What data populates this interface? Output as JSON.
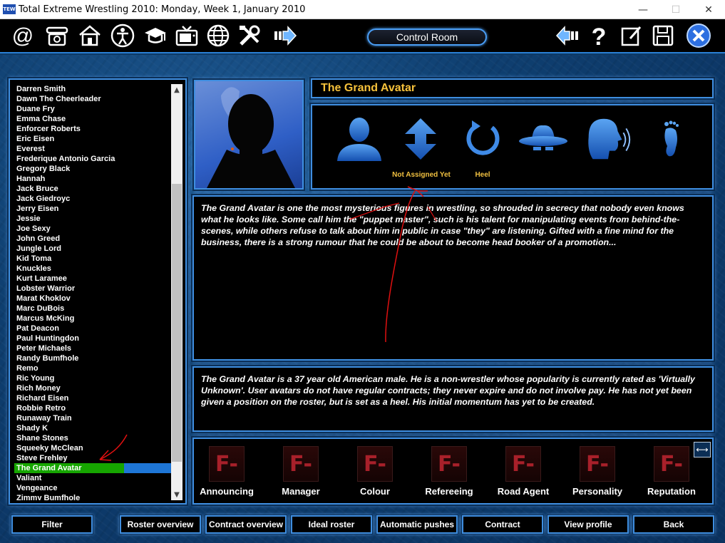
{
  "window": {
    "app_icon_text": "TEW",
    "title": "Total Extreme Wrestling 2010: Monday, Week 1, January 2010",
    "minimize": "—",
    "maximize": "☐",
    "close": "✕"
  },
  "toolbar": {
    "icons": [
      "email-icon",
      "phone-icon",
      "home-icon",
      "person-icon",
      "graduation-cap-icon",
      "tv-icon",
      "globe-icon",
      "tools-icon",
      "forward-arrow-icon"
    ],
    "control_room_label": "Control Room",
    "right_icons": [
      "back-arrow-icon",
      "help-icon",
      "edit-icon",
      "save-icon",
      "close-circle-icon"
    ]
  },
  "roster": {
    "items": [
      "Darren Smith",
      "Dawn The Cheerleader",
      "Duane Fry",
      "Emma Chase",
      "Enforcer Roberts",
      "Eric Eisen",
      "Everest",
      "Frederique Antonio Garcia",
      "Gregory Black",
      "Hannah",
      "Jack Bruce",
      "Jack Giedroyc",
      "Jerry Eisen",
      "Jessie",
      "Joe Sexy",
      "John Greed",
      "Jungle Lord",
      "Kid Toma",
      "Knuckles",
      "Kurt Laramee",
      "Lobster Warrior",
      "Marat Khoklov",
      "Marc DuBois",
      "Marcus McKing",
      "Pat Deacon",
      "Paul Huntingdon",
      "Peter Michaels",
      "Randy Bumfhole",
      "Remo",
      "Ric Young",
      "Rich Money",
      "Richard Eisen",
      "Robbie Retro",
      "Runaway Train",
      "Shady K",
      "Shane Stones",
      "Squeeky McClean",
      "Steve Frehley",
      "The Grand Avatar",
      "Valiant",
      "Vengeance",
      "Zimmy Bumfhole"
    ],
    "selected": "The Grand Avatar",
    "scroll_up": "▲",
    "scroll_down": "▼"
  },
  "worker": {
    "name": "The Grand Avatar",
    "position_label": "Not Assigned Yet",
    "alignment_label": "Heel",
    "description": "The Grand Avatar is one the most mysterious figures in wrestling, so shrouded in secrecy that nobody even knows what he looks like. Some call him the \"puppet master\", such is his talent for manipulating events from behind-the-scenes, while others refuse to talk about him in public in case \"they\" are listening. Gifted with a fine mind for the business, there is a strong rumour that he could be about to become head booker of a promotion...",
    "summary": "The Grand Avatar is a 37 year old American male. He is a non-wrestler whose popularity is currently rated as 'Virtually Unknown'. User avatars do not have regular contracts; they never expire and do not involve pay. He has not yet been given a position on the roster, but is set as a heel. His initial momentum has yet to be created."
  },
  "skills": [
    {
      "label": "Announcing",
      "grade": "F-"
    },
    {
      "label": "Manager",
      "grade": "F-"
    },
    {
      "label": "Colour",
      "grade": "F-"
    },
    {
      "label": "Refereeing",
      "grade": "F-"
    },
    {
      "label": "Road Agent",
      "grade": "F-"
    },
    {
      "label": "Personality",
      "grade": "F-"
    },
    {
      "label": "Reputation",
      "grade": "F-"
    }
  ],
  "swap_label": "⟷",
  "buttons": {
    "filter": "Filter",
    "roster_overview": "Roster overview",
    "contract_overview": "Contract overview",
    "ideal_roster": "Ideal roster",
    "automatic_pushes": "Automatic pushes",
    "contract": "Contract",
    "view_profile": "View profile",
    "back": "Back"
  },
  "colors": {
    "accent_border": "#3f8ee0",
    "name_gold": "#f7c23b",
    "selected_green": "#16a500",
    "grade_red": "#a8202a",
    "annotation_red": "#e01010"
  }
}
